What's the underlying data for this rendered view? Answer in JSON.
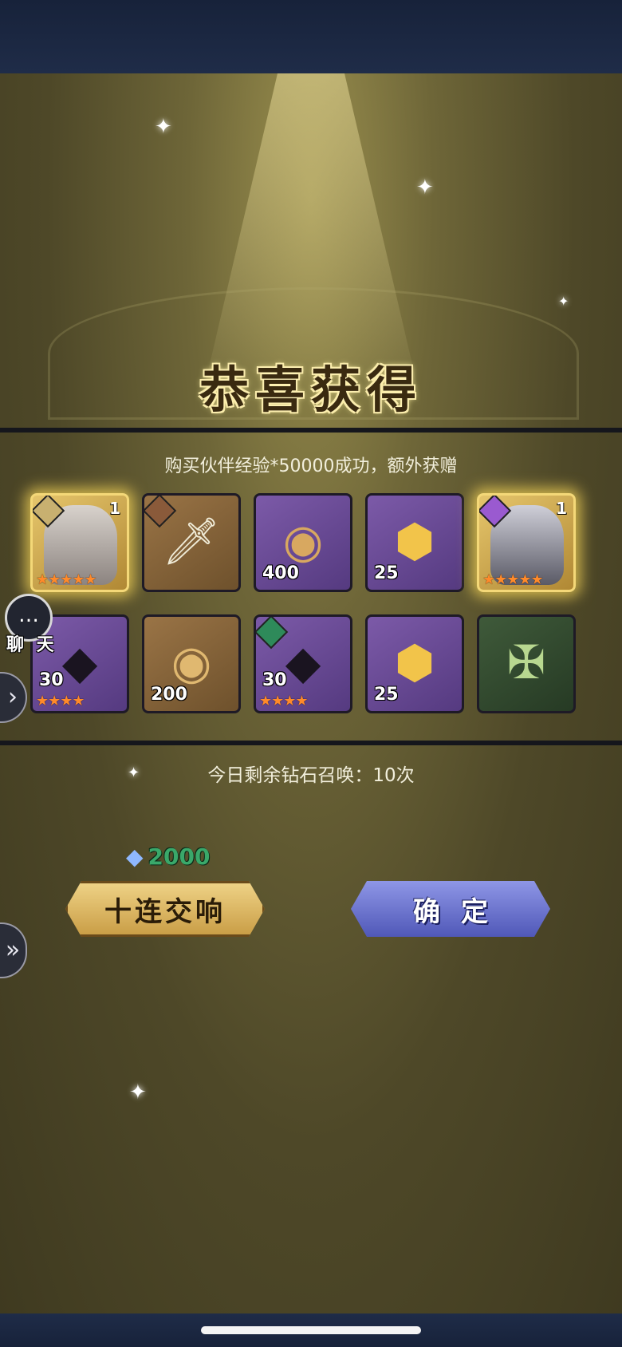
{
  "title": "恭喜获得",
  "subtitle": "购买伙伴经验*50000成功，额外获赠",
  "rewards": [
    {
      "kind": "hero-portrait",
      "frame": "gold",
      "corner": "1",
      "stars": "★★★★★",
      "icon": "hero-female-icon"
    },
    {
      "kind": "weapon",
      "frame": "brown",
      "icon": "sword-icon"
    },
    {
      "kind": "orb",
      "frame": "purple",
      "count": "400",
      "icon": "swirl-orb-icon"
    },
    {
      "kind": "rune",
      "frame": "purple",
      "count": "25",
      "icon": "gold-rune-icon"
    },
    {
      "kind": "hero-portrait",
      "frame": "gold",
      "corner": "1",
      "stars": "★★★★★",
      "icon": "hero-male-icon"
    },
    {
      "kind": "shard",
      "frame": "purple",
      "count": "30",
      "stars": "★★★★",
      "icon": "hooded-shard-icon"
    },
    {
      "kind": "orb",
      "frame": "brown",
      "count": "200",
      "icon": "swirl-orb-icon"
    },
    {
      "kind": "shard",
      "frame": "purple",
      "count": "30",
      "stars": "★★★★",
      "icon": "hooded-shard-icon"
    },
    {
      "kind": "rune",
      "frame": "purple",
      "count": "25",
      "icon": "gold-rune-icon"
    },
    {
      "kind": "emblem",
      "frame": "green",
      "icon": "green-emblem-icon"
    }
  ],
  "chat": {
    "label": "聊 天"
  },
  "summon_info": "今日剩余钻石召唤：10次",
  "cost": {
    "amount": "2000"
  },
  "buttons": {
    "ten_pull": "十连交响",
    "confirm": "确定"
  },
  "colors": {
    "gold": "#e6c66c",
    "purple": "#6a4a98",
    "confirm_blue": "#6a72d0",
    "cost_green": "#3aa86a"
  }
}
